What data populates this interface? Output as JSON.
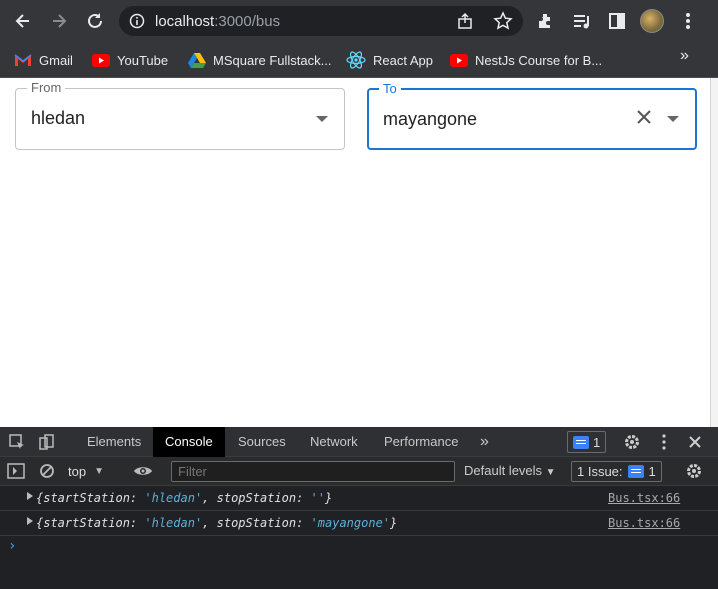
{
  "browser": {
    "url_host": "localhost",
    "url_path": ":3000/bus",
    "bookmarks": [
      {
        "label": "Gmail",
        "icon": "gmail-icon"
      },
      {
        "label": "YouTube",
        "icon": "youtube-icon"
      },
      {
        "label": "MSquare Fullstack...",
        "icon": "google-drive-icon"
      },
      {
        "label": "React App",
        "icon": "react-icon"
      },
      {
        "label": "NestJs Course for B...",
        "icon": "youtube-icon"
      }
    ],
    "more_bookmarks": "»"
  },
  "page": {
    "from": {
      "label": "From",
      "value": "hledan"
    },
    "to": {
      "label": "To",
      "value": "mayangone"
    }
  },
  "devtools": {
    "tabs": [
      "Elements",
      "Console",
      "Sources",
      "Network",
      "Performance"
    ],
    "active_tab": "Console",
    "more_tabs": "»",
    "messages_badge": "1",
    "context": "top",
    "filter_placeholder": "Filter",
    "levels": "Default levels",
    "issues": {
      "label": "1 Issue:",
      "count": "1"
    },
    "logs": [
      {
        "prefix": "{startStation: ",
        "start": "'hledan'",
        "mid": ", stopStation: ",
        "stop": "''",
        "suffix": "}",
        "source": "Bus.tsx:66"
      },
      {
        "prefix": "{startStation: ",
        "start": "'hledan'",
        "mid": ", stopStation: ",
        "stop": "'mayangone'",
        "suffix": "}",
        "source": "Bus.tsx:66"
      }
    ],
    "prompt": "›"
  },
  "colors": {
    "accent": "#1976d2",
    "devtools_bg": "#202124",
    "string": "#5db0d7"
  }
}
